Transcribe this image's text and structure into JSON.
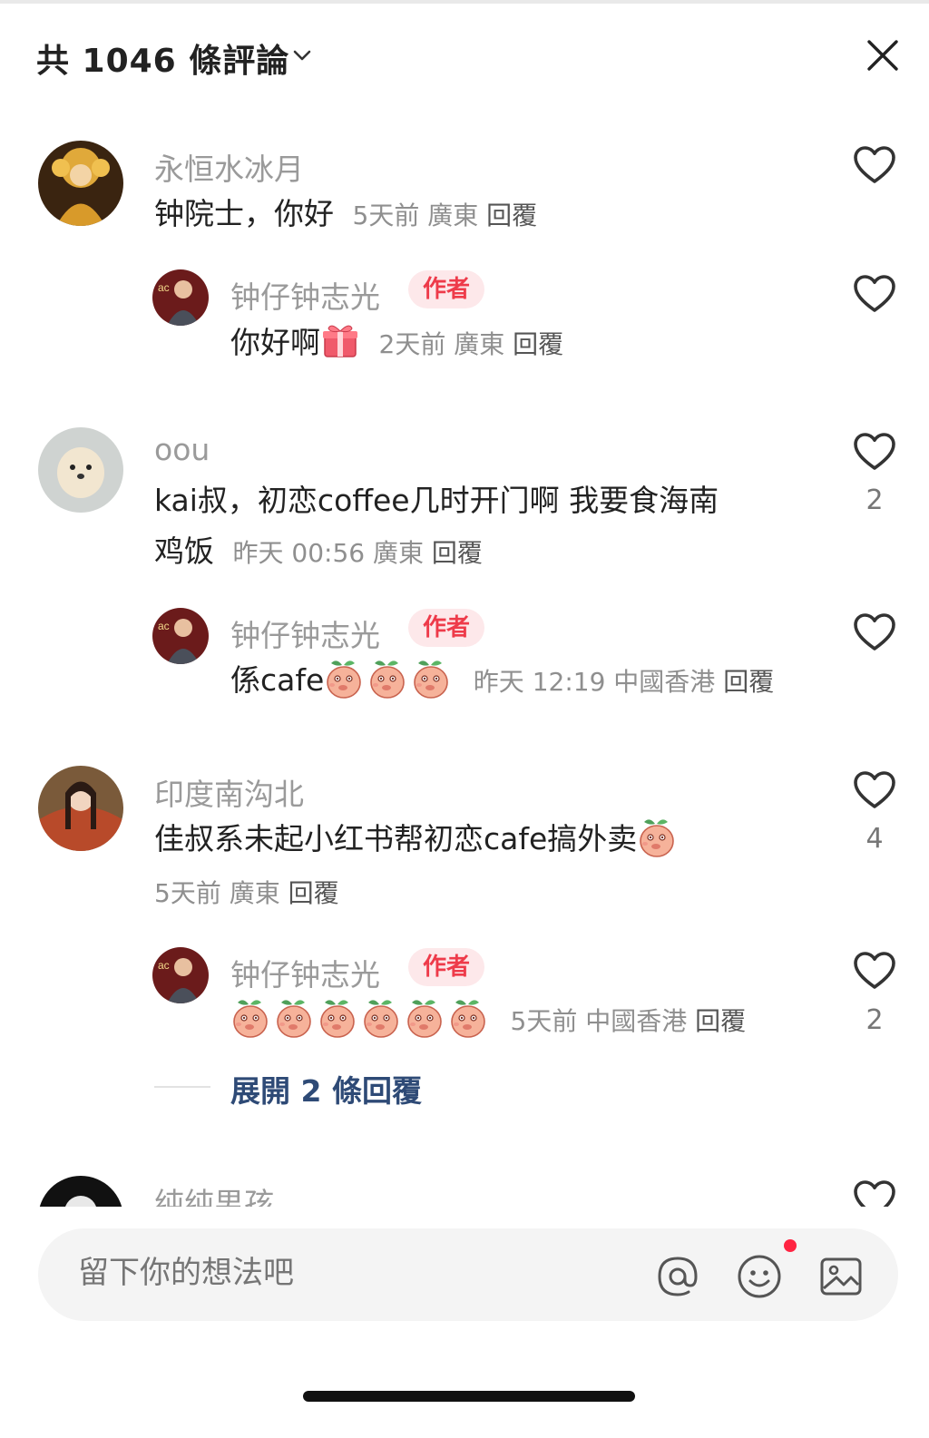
{
  "header": {
    "title": "共 1046 條評論"
  },
  "comments": [
    {
      "user": "永恒水冰月",
      "text": "钟院士，你好",
      "time": "5天前",
      "location": "廣東",
      "reply_label": "回覆",
      "likes": "",
      "replies": [
        {
          "user": "钟仔钟志光",
          "badge": "作者",
          "text": "你好啊",
          "emoji": "gift",
          "time": "2天前",
          "location": "廣東",
          "reply_label": "回覆",
          "likes": ""
        }
      ]
    },
    {
      "user": "oou",
      "text_line1": "kai叔，初恋coffee几时开门啊 我要食海南",
      "text_line2": "鸡饭",
      "time": "昨天 00:56",
      "location": "廣東",
      "reply_label": "回覆",
      "likes": "2",
      "replies": [
        {
          "user": "钟仔钟志光",
          "badge": "作者",
          "text": "係cafe",
          "emoji": "peach x3",
          "time": "昨天 12:19",
          "location": "中國香港",
          "reply_label": "回覆",
          "likes": ""
        }
      ]
    },
    {
      "user": "印度南沟北",
      "text": "佳叔系未起小红书帮初恋cafe搞外卖",
      "emoji": "peach",
      "time": "5天前",
      "location": "廣東",
      "reply_label": "回覆",
      "likes": "4",
      "replies": [
        {
          "user": "钟仔钟志光",
          "badge": "作者",
          "emoji": "peach x6",
          "time": "5天前",
          "location": "中國香港",
          "reply_label": "回覆",
          "likes": "2"
        }
      ],
      "expand_label": "展開 2 條回覆"
    },
    {
      "user": "纯纯男孩"
    }
  ],
  "composer": {
    "placeholder": "留下你的想法吧",
    "icons": [
      "at-icon",
      "emoji-icon",
      "image-icon"
    ]
  },
  "colors": {
    "accent_red": "#ff2442",
    "badge_bg": "#fde8ea",
    "link_blue": "#2e4a76",
    "muted_gray": "#9a9a9a"
  }
}
